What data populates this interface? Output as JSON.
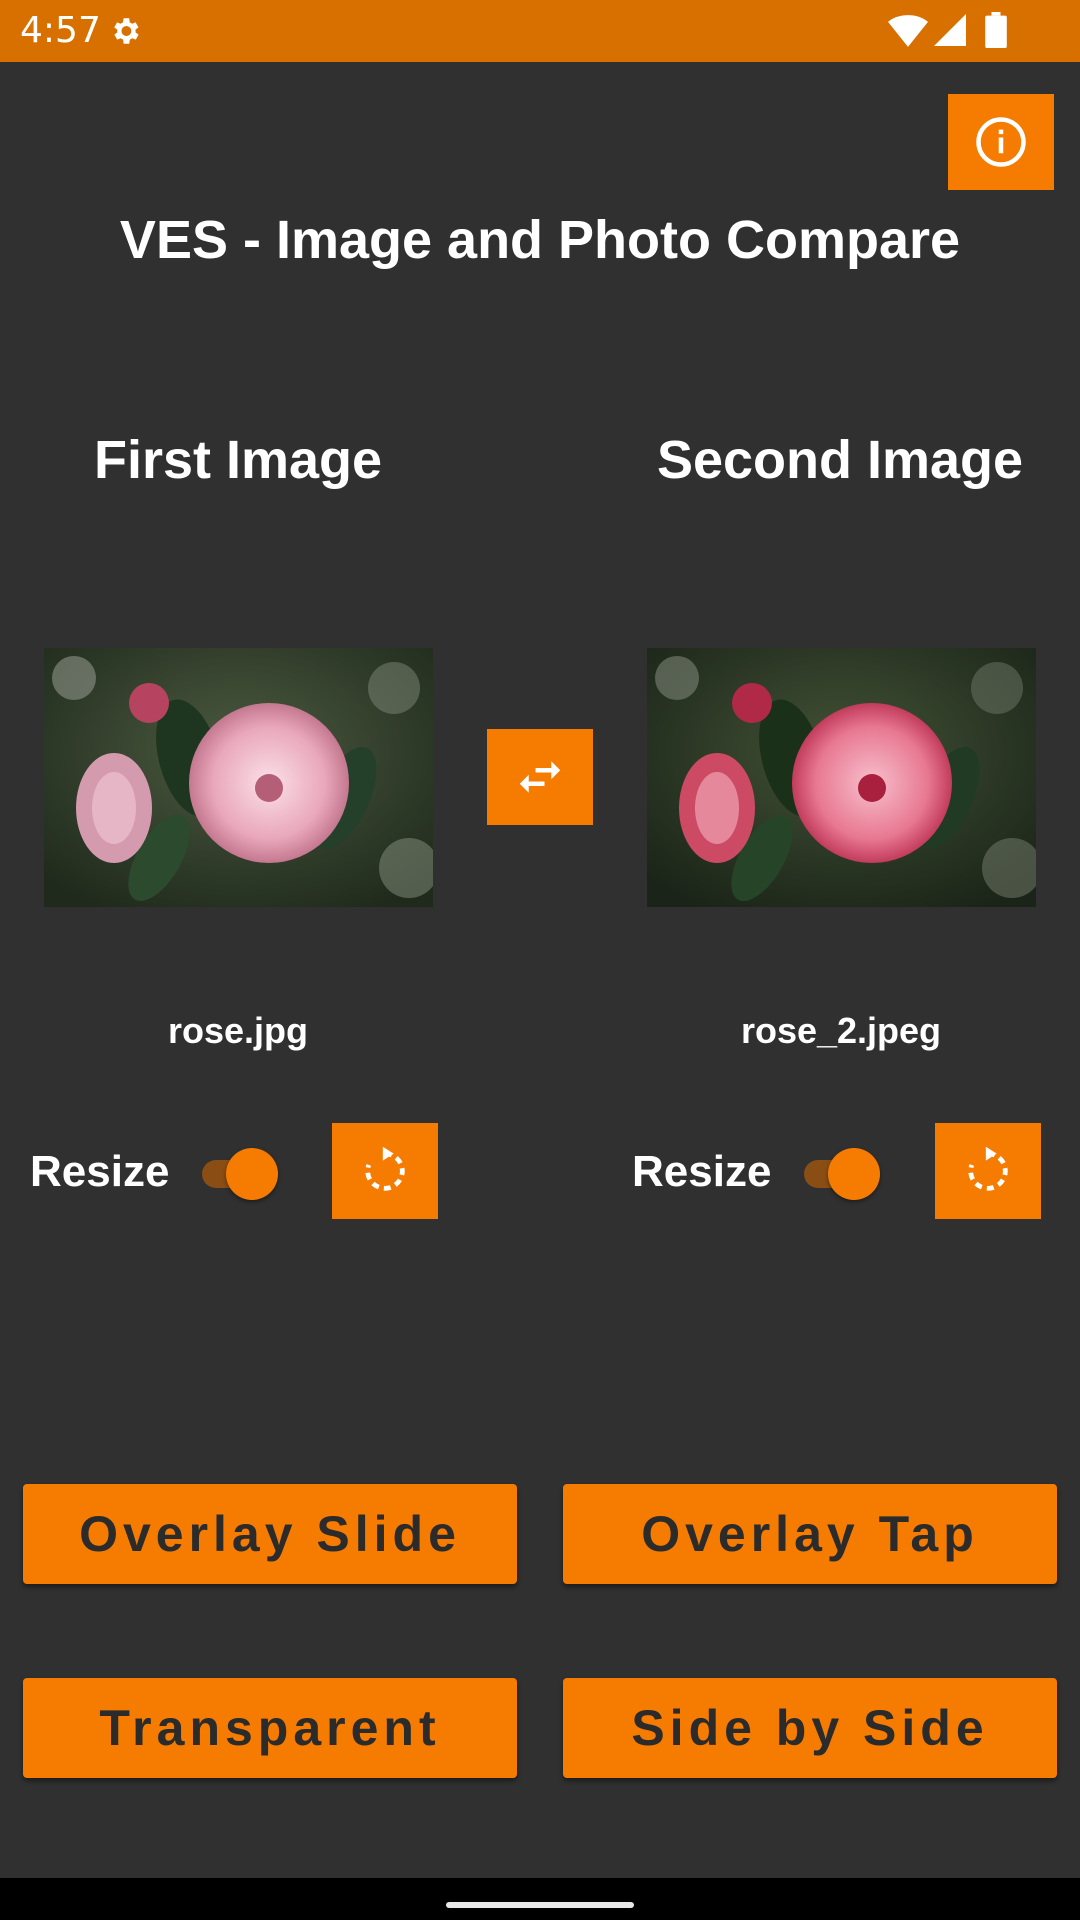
{
  "status_bar": {
    "time": "4:57",
    "icons": [
      "gear-icon",
      "wifi-icon",
      "signal-icon",
      "battery-icon"
    ],
    "background": "#D87000"
  },
  "header": {
    "info_icon": "info-icon",
    "title": "VES - Image and Photo Compare"
  },
  "first": {
    "title": "First Image",
    "filename": "rose.jpg",
    "resize_label": "Resize",
    "resize_on": true,
    "rotate_icon": "rotate-icon"
  },
  "second": {
    "title": "Second Image",
    "filename": "rose_2.jpeg",
    "resize_label": "Resize",
    "resize_on": true,
    "rotate_icon": "rotate-icon"
  },
  "swap_icon": "swap-icon",
  "modes": {
    "overlay_slide": "Overlay Slide",
    "overlay_tap": "Overlay Tap",
    "transparent": "Transparent",
    "side_by_side": "Side by Side"
  },
  "colors": {
    "accent": "#F57C00",
    "background": "#303030",
    "button_text": "#2b2b2b"
  }
}
